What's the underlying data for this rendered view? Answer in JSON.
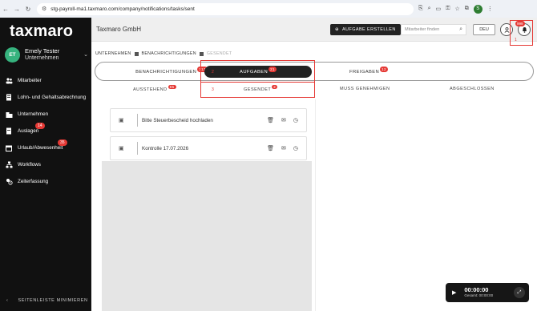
{
  "browser": {
    "url": "stg-payroll-ma1.taxmaro.com/company/notifications/tasks/sent",
    "profile_initial": "S"
  },
  "sidebar": {
    "logo": "taxmaro",
    "user": {
      "initials": "ET",
      "name": "Emely Tester",
      "company": "Unternehmen"
    },
    "items": [
      {
        "label": "Mitarbeiter",
        "icon": "users-icon",
        "badge": ""
      },
      {
        "label": "Lohn- und Gehaltsabrechnung",
        "icon": "document-icon",
        "badge": ""
      },
      {
        "label": "Unternehmen",
        "icon": "building-icon",
        "badge": ""
      },
      {
        "label": "Auslagen",
        "icon": "receipt-icon",
        "badge": "14"
      },
      {
        "label": "Urlaub/Abwesenheit",
        "icon": "calendar-icon",
        "badge": "35"
      },
      {
        "label": "Workflows",
        "icon": "workflow-icon",
        "badge": ""
      },
      {
        "label": "Zeiterfassung",
        "icon": "time-tracking-icon",
        "badge": ""
      }
    ],
    "minimize_label": "SEITENLEISTE MINIMIEREN"
  },
  "header": {
    "company": "Taxmaro GmbH",
    "create_label": "AUFGABE ERSTELLEN",
    "search_placeholder": "Mitarbeiter finden",
    "lang": "DEU",
    "bell_badge": "999",
    "annotation_bell": "1"
  },
  "breadcrumb": [
    "UNTERNEHMEN",
    "BENACHRICHTIGUNGEN",
    "GESENDET"
  ],
  "tabs_main": [
    {
      "label": "BENACHRICHTIGUNGEN",
      "badge": "313"
    },
    {
      "label": "AUFGABEN",
      "badge": "21",
      "annotation": "2",
      "active": true
    },
    {
      "label": "FREIGABEN",
      "badge": "12"
    }
  ],
  "tabs_sub": [
    {
      "label": "AUSSTEHEND",
      "badge": "85"
    },
    {
      "label": "GESENDET",
      "badge": "2",
      "annotation": "3",
      "active": true
    },
    {
      "label": "MUSS GENEHMIGEN",
      "badge": ""
    },
    {
      "label": "ABGESCHLOSSEN",
      "badge": ""
    }
  ],
  "tasks": [
    {
      "title": "Bitte Steuerbescheid hochladen"
    },
    {
      "title": "Kontrolle 17.07.2026"
    }
  ],
  "player": {
    "time": "00:00:00",
    "total": "Gesamt: 00:00:00"
  },
  "colors": {
    "accent": "#e53935",
    "sidebar": "#111111",
    "active_tab": "#222222",
    "avatar": "#36b37e"
  }
}
